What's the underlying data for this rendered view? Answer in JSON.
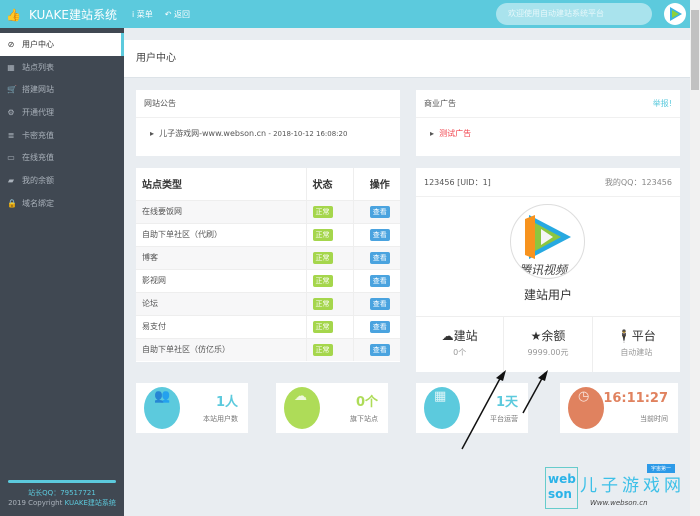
{
  "header": {
    "title": "KUAKE建站系统",
    "menu": "菜单",
    "back": "返回",
    "search_placeholder": "欢迎使用自动建站系统平台"
  },
  "sidebar": {
    "items": [
      {
        "label": "用户中心",
        "icon": "dashboard-icon"
      },
      {
        "label": "站点列表",
        "icon": "table-icon"
      },
      {
        "label": "搭建网站",
        "icon": "cart-icon"
      },
      {
        "label": "开通代理",
        "icon": "gear-icon"
      },
      {
        "label": "卡密充值",
        "icon": "database-icon"
      },
      {
        "label": "在线充值",
        "icon": "card-icon"
      },
      {
        "label": "我的余额",
        "icon": "book-icon"
      },
      {
        "label": "域名绑定",
        "icon": "lock-icon"
      }
    ],
    "qq": "站长QQ：79517721",
    "copyright_prefix": "2019 Copyright ",
    "copyright_brand": "KUAKE建站系统"
  },
  "page_title": "用户中心",
  "notice": {
    "title": "网站公告",
    "item": "儿子游戏网-www.webson.cn",
    "date": " - 2018-10-12 16:08:20"
  },
  "ad": {
    "title": "商业广告",
    "report": "举报!",
    "item": "测试广告"
  },
  "table": {
    "headers": [
      "站点类型",
      "状态",
      "操作"
    ],
    "rows": [
      {
        "name": "在线要饭网",
        "status": "正常",
        "action": "查看"
      },
      {
        "name": "自助下单社区（代刷）",
        "status": "正常",
        "action": "查看"
      },
      {
        "name": "博客",
        "status": "正常",
        "action": "查看"
      },
      {
        "name": "影视网",
        "status": "正常",
        "action": "查看"
      },
      {
        "name": "论坛",
        "status": "正常",
        "action": "查看"
      },
      {
        "name": "易支付",
        "status": "正常",
        "action": "查看"
      },
      {
        "name": "自助下单社区（仿亿乐）",
        "status": "正常",
        "action": "查看"
      }
    ]
  },
  "user": {
    "account": "123456 [UID：1]",
    "qq": "我的QQ：123456",
    "avatar_text": "腾讯视频",
    "name": "建站用户",
    "stats": [
      {
        "label": "建站",
        "value": "0个",
        "icon": "cloud-icon"
      },
      {
        "label": "余额",
        "value": "9999.00元",
        "icon": "star-icon"
      },
      {
        "label": "平台",
        "value": "自动建站",
        "icon": "user-icon"
      }
    ]
  },
  "stats": [
    {
      "value": "1人",
      "label": "本站用户数",
      "color": "#5ccadd",
      "icon": "users-icon"
    },
    {
      "value": "0个",
      "label": "旗下站点",
      "color": "#aedc58",
      "icon": "cloud-icon"
    },
    {
      "value": "1天",
      "label": "平台运营",
      "color": "#5ccadd",
      "icon": "calendar-icon"
    },
    {
      "value": "16:11:27",
      "label": "当前时间",
      "color": "#e0825f",
      "icon": "clock-icon"
    }
  ],
  "watermark": {
    "text": "儿子游戏网",
    "url": "www.webson.cn",
    "tag": "宇宙第一",
    "logo": "webson"
  },
  "colors": {
    "header": "#5ccadd",
    "sidebar": "#404852",
    "ok": "#a5d64c",
    "view": "#4aa3df",
    "ad": "#f0414b"
  }
}
